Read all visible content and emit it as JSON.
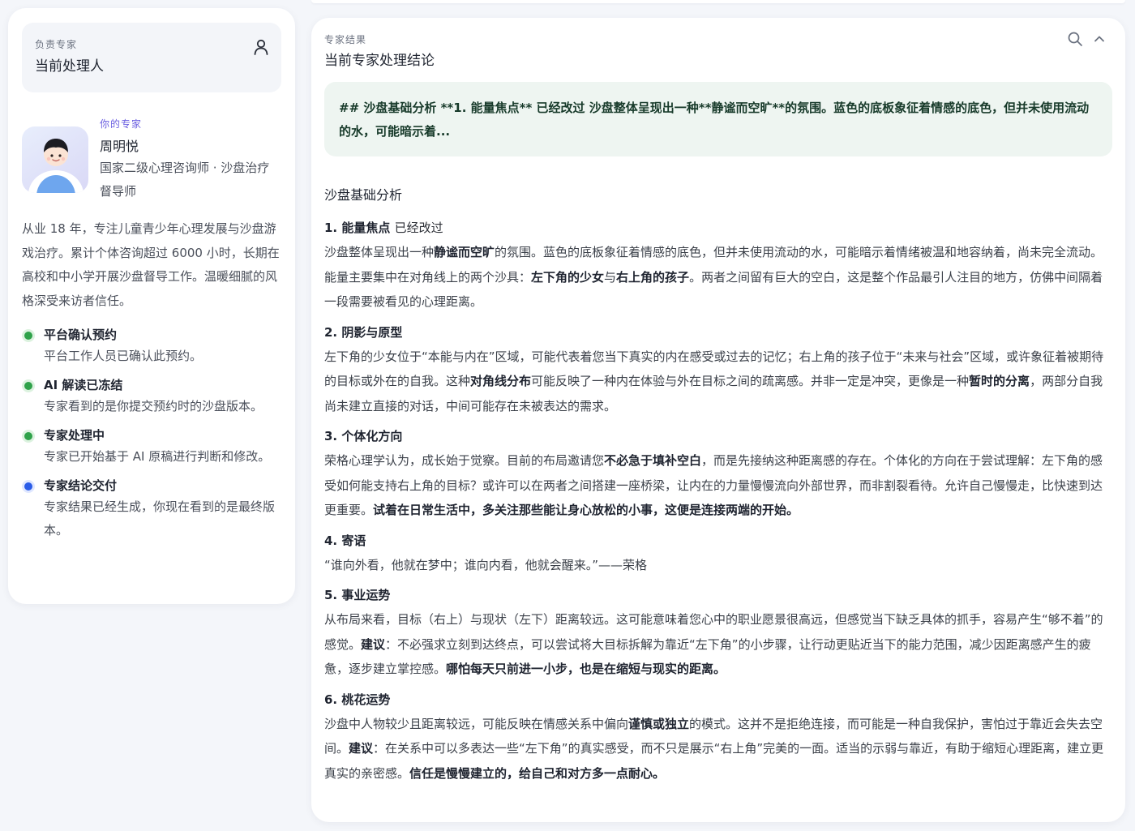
{
  "owner": {
    "eyebrow": "负责专家",
    "title": "当前处理人",
    "icon": "user-icon"
  },
  "expert": {
    "eyebrow": "你的专家",
    "name": "周明悦",
    "title": "国家二级心理咨询师 · 沙盘治疗督导师",
    "bio": "从业 18 年，专注儿童青少年心理发展与沙盘游戏治疗。累计个体咨询超过 6000 小时，长期在高校和中小学开展沙盘督导工作。温暖细腻的风格深受来访者信任。"
  },
  "timeline": [
    {
      "title": "平台确认预约",
      "desc": "平台工作人员已确认此预约。",
      "status": "done",
      "color": "#2fa24a"
    },
    {
      "title": "AI 解读已冻结",
      "desc": "专家看到的是你提交预约时的沙盘版本。",
      "status": "done",
      "color": "#2fa24a"
    },
    {
      "title": "专家处理中",
      "desc": "专家已开始基于 AI 原稿进行判断和修改。",
      "status": "done",
      "color": "#2fa24a"
    },
    {
      "title": "专家结论交付",
      "desc": "专家结果已经生成，你现在看到的是最终版本。",
      "status": "current",
      "color": "#2a5ce8"
    }
  ],
  "result": {
    "eyebrow": "专家结果",
    "title": "当前专家处理结论",
    "actions": [
      "search-icon",
      "chevron-up-icon"
    ],
    "summary": "## 沙盘基础分析 **1. 能量焦点** 已经改过 沙盘整体呈现出一种**静谧而空旷**的氛围。蓝色的底板象征着情感的底色，但并未使用流动的水，可能暗示着...",
    "heading": "沙盘基础分析",
    "sections": {
      "s1": {
        "title": "1. 能量焦点",
        "note": "已经改过",
        "p1": "沙盘整体呈现出一种",
        "b1": "静谧而空旷",
        "p2": "的氛围。蓝色的底板象征着情感的底色，但并未使用流动的水，可能暗示着情绪被温和地容纳着，尚未完全流动。能量主要集中在对角线上的两个沙具：",
        "b2": "左下角的少女",
        "p3": "与",
        "b3": "右上角的孩子",
        "p4": "。两者之间留有巨大的空白，这是整个作品最引人注目的地方，仿佛中间隔着一段需要被看见的心理距离。"
      },
      "s2": {
        "title": "2. 阴影与原型",
        "p1": "左下角的少女位于“本能与内在”区域，可能代表着您当下真实的内在感受或过去的记忆；右上角的孩子位于“未来与社会”区域，或许象征着被期待的目标或外在的自我。这种",
        "b1": "对角线分布",
        "p2": "可能反映了一种内在体验与外在目标之间的疏离感。并非一定是冲突，更像是一种",
        "b2": "暂时的分离",
        "p3": "，两部分自我尚未建立直接的对话，中间可能存在未被表达的需求。"
      },
      "s3": {
        "title": "3. 个体化方向",
        "p1": "荣格心理学认为，成长始于觉察。目前的布局邀请您",
        "b1": "不必急于填补空白",
        "p2": "，而是先接纳这种距离感的存在。个体化的方向在于尝试理解：左下角的感受如何能支持右上角的目标？或许可以在两者之间搭建一座桥梁，让内在的力量慢慢流向外部世界，而非割裂看待。允许自己慢慢走，比快速到达更重要。",
        "b2": "试着在日常生活中，多关注那些能让身心放松的小事，这便是连接两端的开始。"
      },
      "s4": {
        "title": "4. 寄语",
        "p1": "“谁向外看，他就在梦中；谁向内看，他就会醒来。”——荣格"
      },
      "s5": {
        "title": "5. 事业运势",
        "p1": "从布局来看，目标（右上）与现状（左下）距离较远。这可能意味着您心中的职业愿景很高远，但感觉当下缺乏具体的抓手，容易产生“够不着”的感觉。",
        "b1": "建议",
        "p2": "：不必强求立刻到达终点，可以尝试将大目标拆解为靠近“左下角”的小步骤，让行动更贴近当下的能力范围，减少因距离感产生的疲惫，逐步建立掌控感。",
        "b2": "哪怕每天只前进一小步，也是在缩短与现实的距离。"
      },
      "s6": {
        "title": "6. 桃花运势",
        "p1": "沙盘中人物较少且距离较远，可能反映在情感关系中偏向",
        "b1": "谨慎或独立",
        "p2": "的模式。这并不是拒绝连接，而可能是一种自我保护，害怕过于靠近会失去空间。",
        "b2": "建议",
        "p3": "：在关系中可以多表达一些“左下角”的真实感受，而不只是展示“右上角”完美的一面。适当的示弱与靠近，有助于缩短心理距离，建立更真实的亲密感。",
        "b3": "信任是慢慢建立的，给自己和对方多一点耐心。"
      }
    }
  }
}
